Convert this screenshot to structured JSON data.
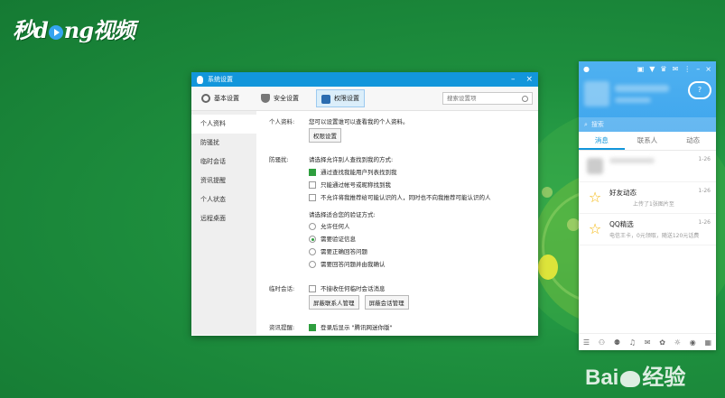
{
  "watermarks": {
    "top_left": "秒dong视频",
    "bottom_right": "Baidu经验"
  },
  "dialog": {
    "title": "系统设置",
    "controls": {
      "minimize": "–",
      "close": "×"
    },
    "tabs": [
      {
        "label": "基本设置",
        "icon": "gear-icon"
      },
      {
        "label": "安全设置",
        "icon": "shield-icon"
      },
      {
        "label": "权限设置",
        "icon": "lock-icon",
        "active": true
      }
    ],
    "search_placeholder": "搜索设置项",
    "sidebar": [
      "个人资料",
      "防骚扰",
      "临时会话",
      "资讯提醒",
      "个人状态",
      "远程桌面"
    ],
    "sections": {
      "profile": {
        "label": "个人资料:",
        "desc": "您可以设置谁可以查看我的个人资料。",
        "button": "权限设置"
      },
      "harass": {
        "label": "防骚扰:",
        "prompt1": "请选择允许别人查找到我的方式:",
        "options": [
          {
            "label": "通过查找我能用户列表找到我",
            "checked": true
          },
          {
            "label": "只能通过帐号或昵称找到我",
            "checked": false
          },
          {
            "label": "不允许将我推荐给可能认识的人，同时也不向我推荐可能认识的人",
            "checked": false
          }
        ],
        "prompt2": "请选择适合您的验证方式:",
        "radios": [
          {
            "label": "允许任何人",
            "selected": false
          },
          {
            "label": "需要验证信息",
            "selected": true
          },
          {
            "label": "需要正确回答问题",
            "selected": false
          },
          {
            "label": "需要回答问题并由我确认",
            "selected": false
          }
        ]
      },
      "temp": {
        "label": "临时会话:",
        "option": "不接收任何临时会话消息",
        "buttons": [
          "屏蔽联系人管理",
          "屏蔽会话管理"
        ]
      },
      "news": {
        "label": "资讯提醒:",
        "option": "登录后显示 \"腾讯网迷你版\""
      }
    }
  },
  "qq": {
    "search": "搜索",
    "tabs": [
      "消息",
      "联系人",
      "动态"
    ],
    "items": [
      {
        "name": "",
        "sub": "",
        "time": "1-26",
        "icon": "avatar"
      },
      {
        "name": "好友动态",
        "sub": "上传了1张图片至",
        "time": "1-26",
        "icon": "star-icon"
      },
      {
        "name": "QQ精选",
        "sub": "电信王卡，0元领取，随送120元话费",
        "time": "1-26",
        "icon": "star-icon"
      }
    ]
  }
}
